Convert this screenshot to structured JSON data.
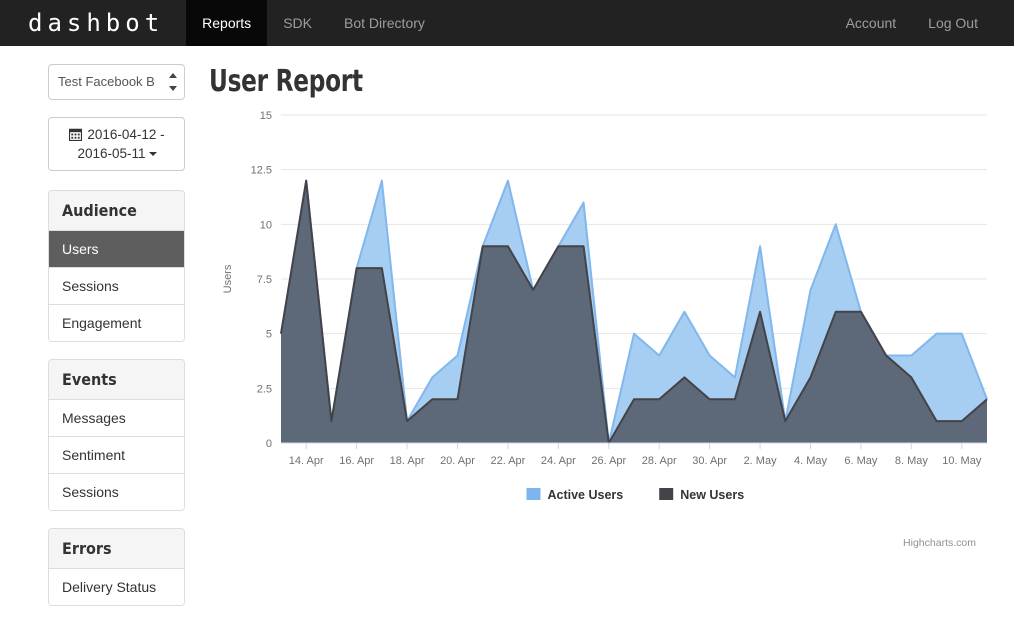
{
  "navbar": {
    "brand": "dashbot",
    "links": [
      {
        "label": "Reports",
        "active": true
      },
      {
        "label": "SDK",
        "active": false
      },
      {
        "label": "Bot Directory",
        "active": false
      }
    ],
    "right_links": [
      {
        "label": "Account"
      },
      {
        "label": "Log Out"
      }
    ]
  },
  "sidebar": {
    "bot_select": {
      "value": "Test Facebook B",
      "icon": "spinner-arrows-icon"
    },
    "date_range": {
      "icon": "calendar-icon",
      "start": "2016-04-12",
      "end": "2016-05-11",
      "line1": "2016-04-12 -",
      "line2": "2016-05-11"
    },
    "panels": [
      {
        "title": "Audience",
        "items": [
          {
            "label": "Users",
            "active": true
          },
          {
            "label": "Sessions",
            "active": false
          },
          {
            "label": "Engagement",
            "active": false
          }
        ]
      },
      {
        "title": "Events",
        "items": [
          {
            "label": "Messages",
            "active": false
          },
          {
            "label": "Sentiment",
            "active": false
          },
          {
            "label": "Sessions",
            "active": false
          }
        ]
      },
      {
        "title": "Errors",
        "items": [
          {
            "label": "Delivery Status",
            "active": false
          }
        ]
      }
    ]
  },
  "main": {
    "page_title": "User Report",
    "credit": "Highcharts.com"
  },
  "colors": {
    "active_users": "#7cb5ec",
    "active_users_fill": "#a6cdf2",
    "new_users": "#434348",
    "new_users_fill": "#5b6475",
    "navbar_bg": "#222222",
    "active_item_bg": "#5e5e5e",
    "grid": "#e6e6e6",
    "axis_text": "#707073"
  },
  "chart_data": {
    "type": "area",
    "title": "User Report",
    "subtitle": "",
    "xlabel": "",
    "ylabel": "Users",
    "ylim": [
      0,
      15
    ],
    "yticks": [
      0,
      2.5,
      5,
      7.5,
      10,
      12.5,
      15
    ],
    "ytick_labels": [
      "0",
      "2.5",
      "5",
      "7.5",
      "10",
      "12.5",
      "15"
    ],
    "grid": true,
    "legend_position": "bottom",
    "x": [
      "13. Apr",
      "14. Apr",
      "15. Apr",
      "16. Apr",
      "17. Apr",
      "18. Apr",
      "19. Apr",
      "20. Apr",
      "21. Apr",
      "22. Apr",
      "23. Apr",
      "24. Apr",
      "25. Apr",
      "26. Apr",
      "27. Apr",
      "28. Apr",
      "29. Apr",
      "30. Apr",
      "1. May",
      "2. May",
      "3. May",
      "4. May",
      "5. May",
      "6. May",
      "7. May",
      "8. May",
      "9. May",
      "10. May",
      "11. May"
    ],
    "xtick_labels": [
      "14. Apr",
      "16. Apr",
      "18. Apr",
      "20. Apr",
      "22. Apr",
      "24. Apr",
      "26. Apr",
      "28. Apr",
      "30. Apr",
      "2. May",
      "4. May",
      "6. May",
      "8. May",
      "10. May"
    ],
    "xtick_indices": [
      1,
      3,
      5,
      7,
      9,
      11,
      13,
      15,
      17,
      19,
      21,
      23,
      25,
      27
    ],
    "series": [
      {
        "name": "Active Users",
        "color": "#7cb5ec",
        "values": [
          5,
          12,
          1,
          8,
          12,
          1,
          3,
          4,
          9,
          12,
          7,
          9,
          11,
          0,
          5,
          4,
          6,
          4,
          3,
          9,
          1,
          7,
          10,
          6,
          4,
          4,
          5,
          5,
          2
        ]
      },
      {
        "name": "New Users",
        "color": "#434348",
        "values": [
          5,
          12,
          1,
          8,
          8,
          1,
          2,
          2,
          9,
          9,
          7,
          9,
          9,
          0,
          2,
          2,
          3,
          2,
          2,
          6,
          1,
          3,
          6,
          6,
          4,
          3,
          1,
          1,
          2
        ]
      }
    ]
  }
}
